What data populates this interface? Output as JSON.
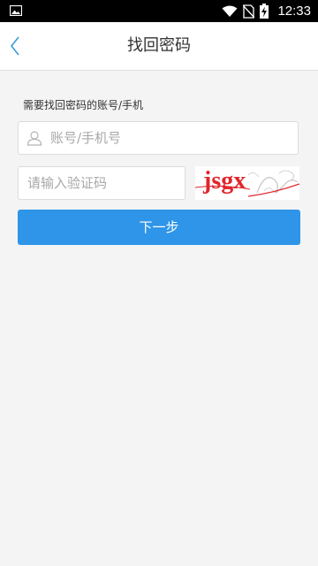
{
  "status_bar": {
    "time": "12:33",
    "icons": [
      "image-icon",
      "wifi-icon",
      "no-sim-icon",
      "battery-charging-icon"
    ]
  },
  "header": {
    "back_icon": "chevron-left-icon",
    "title": "找回密码"
  },
  "form": {
    "label": "需要找回密码的账号/手机",
    "account": {
      "placeholder": "账号/手机号",
      "value": "",
      "icon": "user-icon"
    },
    "captcha": {
      "placeholder": "请输入验证码",
      "value": "",
      "image_text": "jsgx"
    },
    "next_label": "下一步"
  },
  "colors": {
    "accent": "#2f95e8",
    "back_icon": "#3a9ad9",
    "captcha_text": "#e1252b",
    "background": "#f4f4f4"
  }
}
